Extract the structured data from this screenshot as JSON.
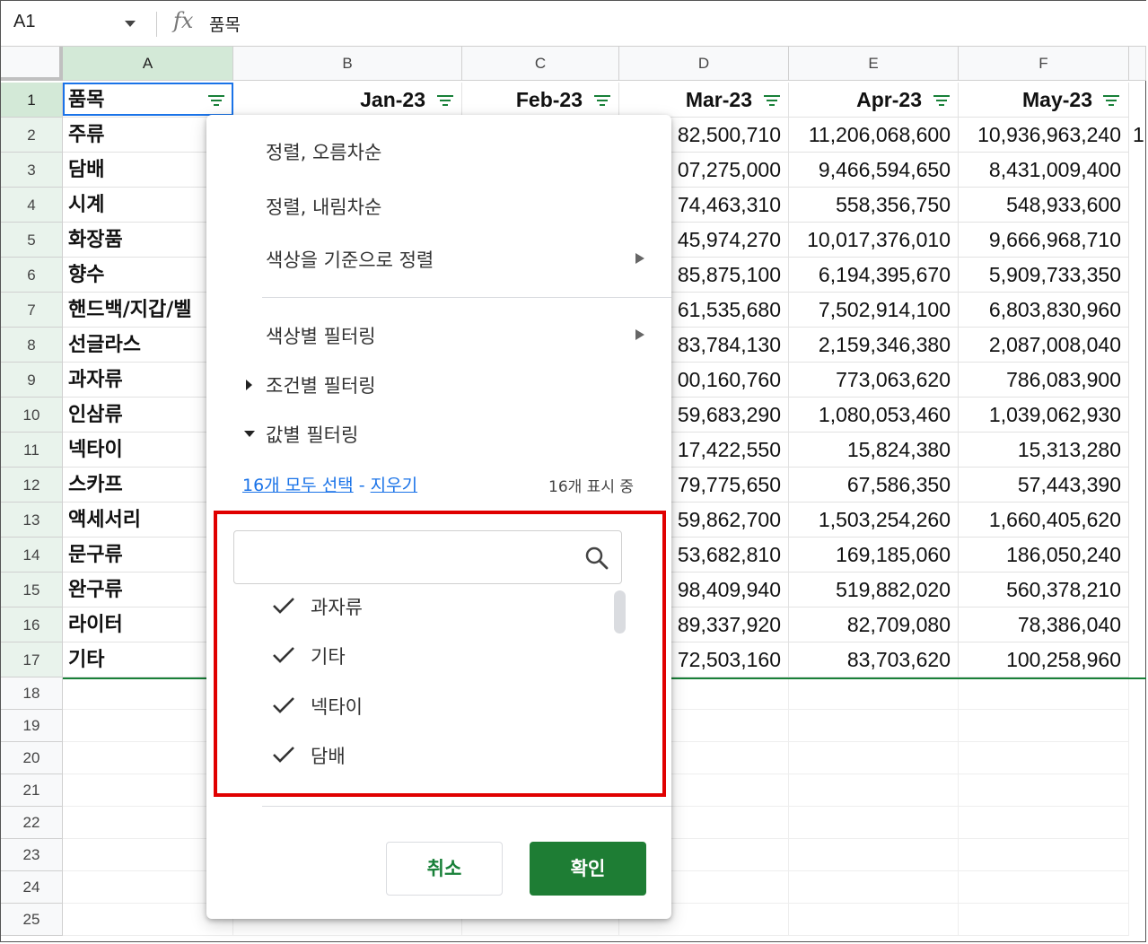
{
  "formula_bar": {
    "name_box": "A1",
    "fx_symbol": "fx",
    "value": "품목"
  },
  "columns": [
    "A",
    "B",
    "C",
    "D",
    "E",
    "F"
  ],
  "rows": [
    "1",
    "2",
    "3",
    "4",
    "5",
    "6",
    "7",
    "8",
    "9",
    "10",
    "11",
    "12",
    "13",
    "14",
    "15",
    "16",
    "17",
    "18",
    "19",
    "20",
    "21",
    "22",
    "23",
    "24",
    "25"
  ],
  "header_row": {
    "A": "품목",
    "B": "Jan-23",
    "C": "Feb-23",
    "D": "Mar-23",
    "E": "Apr-23",
    "F": "May-23"
  },
  "items": [
    "주류",
    "담배",
    "시계",
    "화장품",
    "향수",
    "핸드백/지갑/벨",
    "선글라스",
    "과자류",
    "인삼류",
    "넥타이",
    "스카프",
    "액세서리",
    "문구류",
    "완구류",
    "라이터",
    "기타"
  ],
  "col_D": [
    "82,500,710",
    "07,275,000",
    "74,463,310",
    "45,974,270",
    "85,875,100",
    "61,535,680",
    "83,784,130",
    "00,160,760",
    "59,683,290",
    "17,422,550",
    "79,775,650",
    "59,862,700",
    "53,682,810",
    "98,409,940",
    "89,337,920",
    "72,503,160"
  ],
  "col_E": [
    "11,206,068,600",
    "9,466,594,650",
    "558,356,750",
    "10,017,376,010",
    "6,194,395,670",
    "7,502,914,100",
    "2,159,346,380",
    "773,063,620",
    "1,080,053,460",
    "15,824,380",
    "67,586,350",
    "1,503,254,260",
    "169,185,060",
    "519,882,020",
    "82,709,080",
    "83,703,620"
  ],
  "col_F": [
    "10,936,963,240",
    "8,431,009,400",
    "548,933,600",
    "9,666,968,710",
    "5,909,733,350",
    "6,803,830,960",
    "2,087,008,040",
    "786,083,900",
    "1,039,062,930",
    "15,313,280",
    "57,443,390",
    "1,660,405,620",
    "186,050,240",
    "560,378,210",
    "78,386,040",
    "100,258,960"
  ],
  "col_G_partial": "1",
  "filter_menu": {
    "sort_asc": "정렬, 오름차순",
    "sort_desc": "정렬, 내림차순",
    "sort_by_color": "색상을 기준으로 정렬",
    "filter_by_color": "색상별 필터링",
    "filter_by_condition": "조건별 필터링",
    "filter_by_values": "값별 필터링",
    "select_all": "16개 모두 선택",
    "link_separator": "-",
    "clear": "지우기",
    "showing": "16개 표시 중",
    "search_placeholder": "",
    "values": [
      "과자류",
      "기타",
      "넥타이",
      "담배"
    ],
    "cancel": "취소",
    "ok": "확인"
  },
  "colors": {
    "accent_green": "#188038",
    "ok_button": "#1e7d34",
    "link_blue": "#1a73e8",
    "highlight_red": "#e00000",
    "selected_header": "#d3e9d7"
  }
}
